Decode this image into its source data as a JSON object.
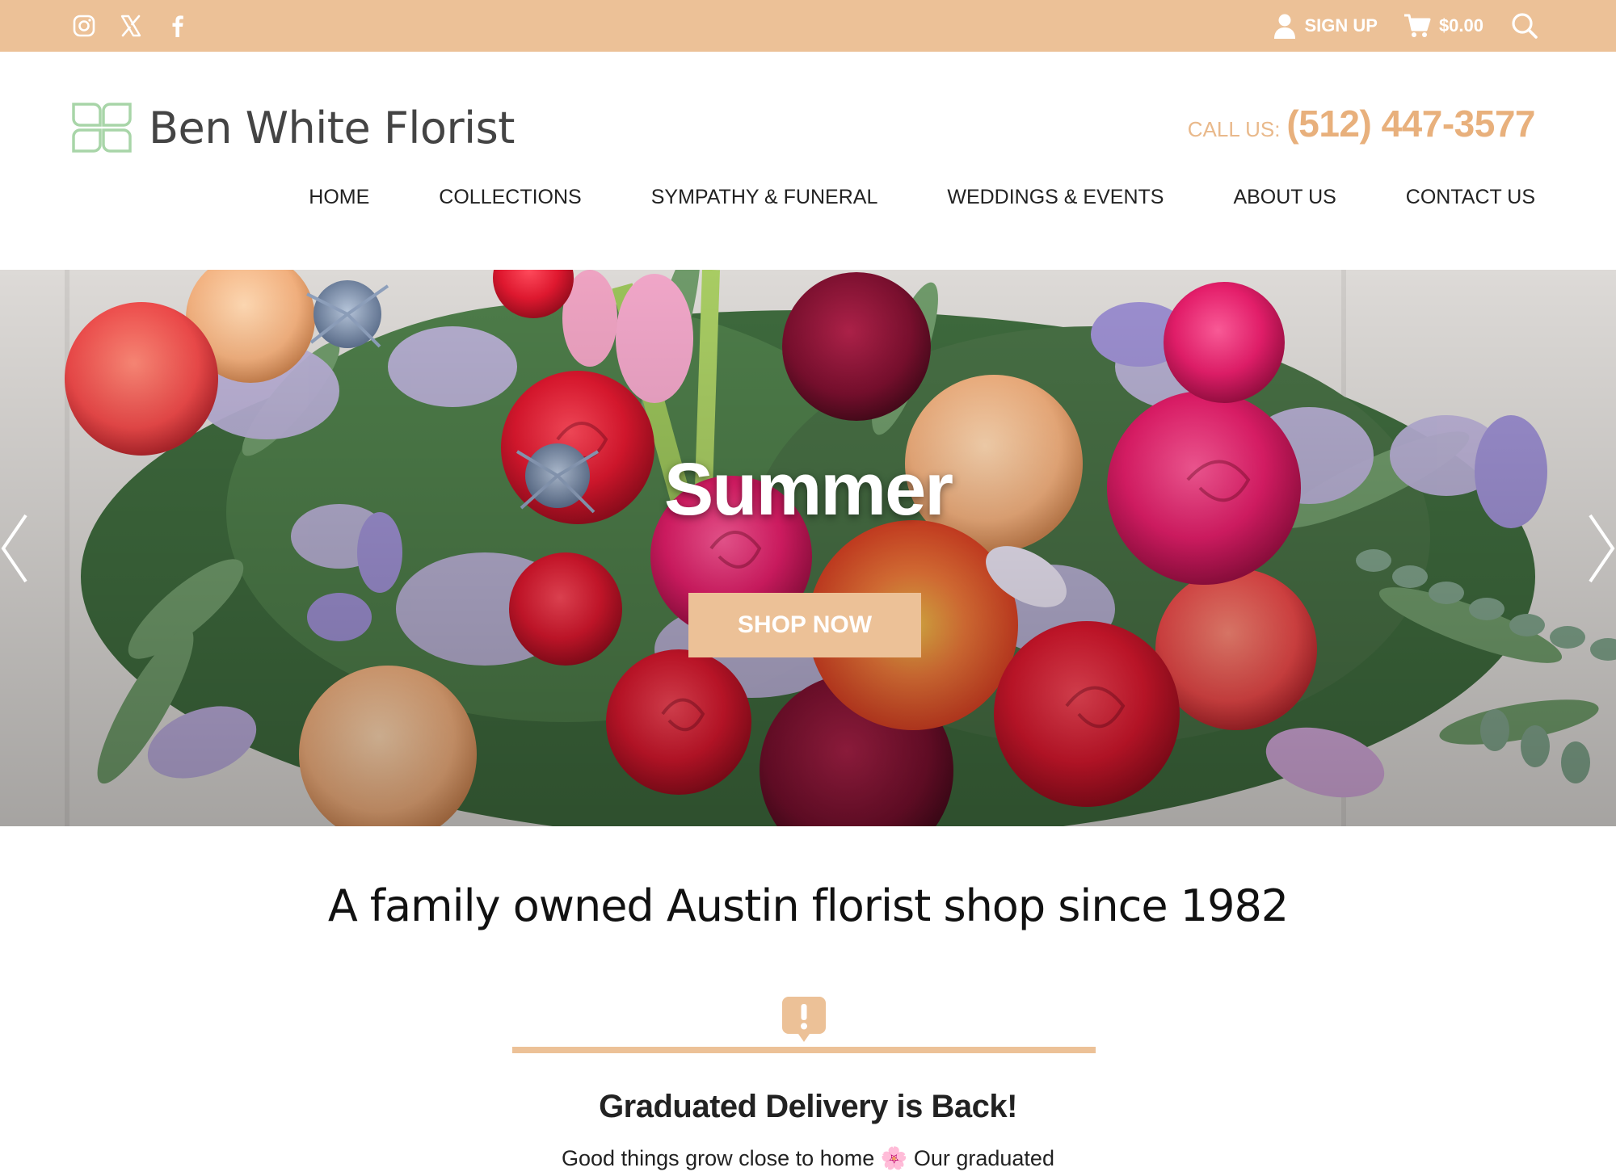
{
  "topbar": {
    "social": [
      {
        "icon": "instagram-icon"
      },
      {
        "icon": "x-icon"
      },
      {
        "icon": "facebook-icon"
      }
    ],
    "signup_label": "SIGN UP",
    "cart_total": "$0.00",
    "background_color": "#ecc197"
  },
  "header": {
    "logo_name": "Ben White Florist",
    "logo_icon": "leaf-grid-icon",
    "call_label": "CALL US:",
    "phone": "(512) 447-3577"
  },
  "nav": {
    "items": [
      {
        "label": "HOME"
      },
      {
        "label": "COLLECTIONS"
      },
      {
        "label": "SYMPATHY & FUNERAL"
      },
      {
        "label": "WEDDINGS & EVENTS"
      },
      {
        "label": "ABOUT US"
      },
      {
        "label": "CONTACT US"
      }
    ]
  },
  "hero": {
    "title": "Summer",
    "button_label": "SHOP NOW",
    "prev_icon": "chevron-left-icon",
    "next_icon": "chevron-right-icon"
  },
  "intro": {
    "tagline": "A family owned Austin florist shop since 1982"
  },
  "notice": {
    "icon": "alert-speech-bubble-icon",
    "title": "Graduated Delivery is Back!",
    "text": "Good things grow close to home 🌸 Our graduated"
  },
  "colors": {
    "accent": "#ecc197",
    "phone": "#e8b07c",
    "logo_green": "#a8d5a8"
  }
}
